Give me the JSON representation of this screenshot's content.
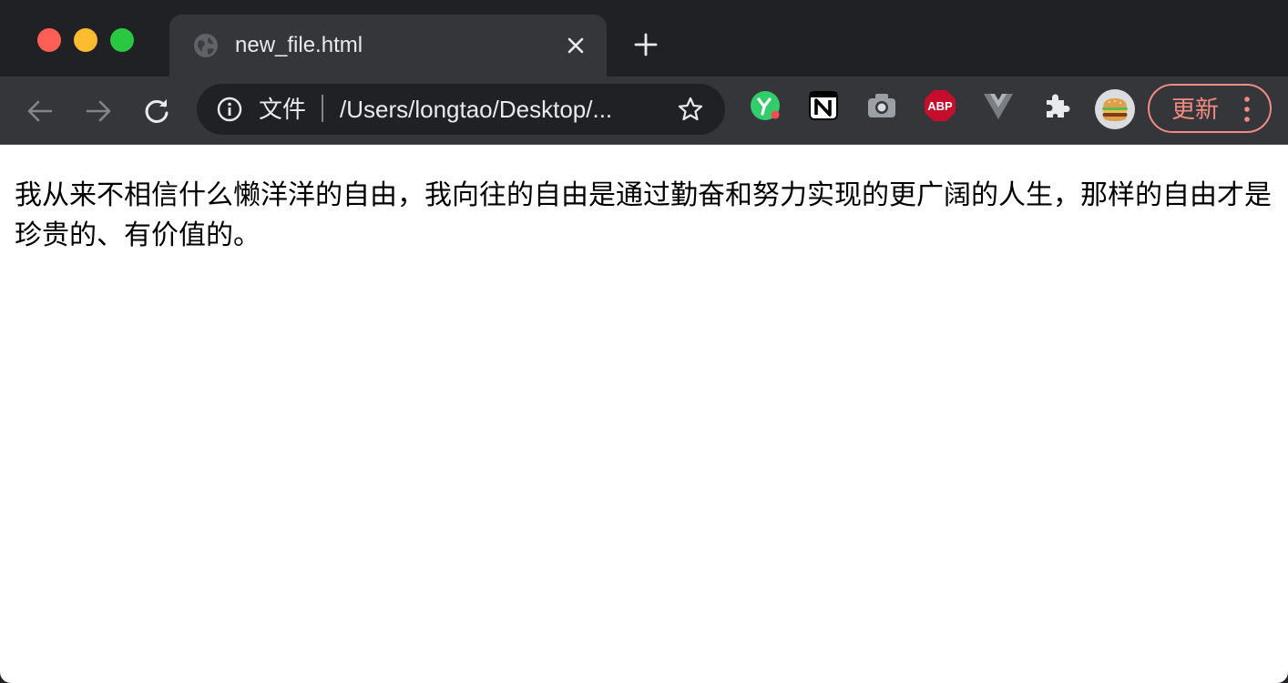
{
  "window": {
    "controls": [
      "close",
      "minimize",
      "maximize"
    ]
  },
  "tab": {
    "title": "new_file.html",
    "favicon": "globe-icon",
    "close_icon": "close-icon"
  },
  "toolbar": {
    "back_icon": "back-arrow-icon",
    "forward_icon": "forward-arrow-icon",
    "reload_icon": "reload-icon",
    "omnibox": {
      "scheme_label": "文件",
      "url": "/Users/longtao/Desktop/...",
      "info_icon": "info-icon",
      "bookmark_icon": "star-icon"
    },
    "extensions": [
      "yuque-extension-icon",
      "notion-extension-icon",
      "camera-extension-icon",
      "adblock-plus-extension-icon",
      "vue-devtools-extension-icon",
      "puzzle-extensions-icon"
    ],
    "extension_labels": {
      "abp": "ABP"
    },
    "profile_avatar": "burger-avatar-icon",
    "update_button": {
      "label": "更新"
    }
  },
  "content": {
    "paragraph": "我从来不相信什么懒洋洋的自由，我向往的自由是通过勤奋和努力实现的更广阔的人生，那样的自由才是珍贵的、有价值的。"
  },
  "colors": {
    "tabstrip_bg": "#202124",
    "toolbar_bg": "#35363a",
    "update_accent": "#f28b82",
    "page_bg": "#ffffff"
  }
}
